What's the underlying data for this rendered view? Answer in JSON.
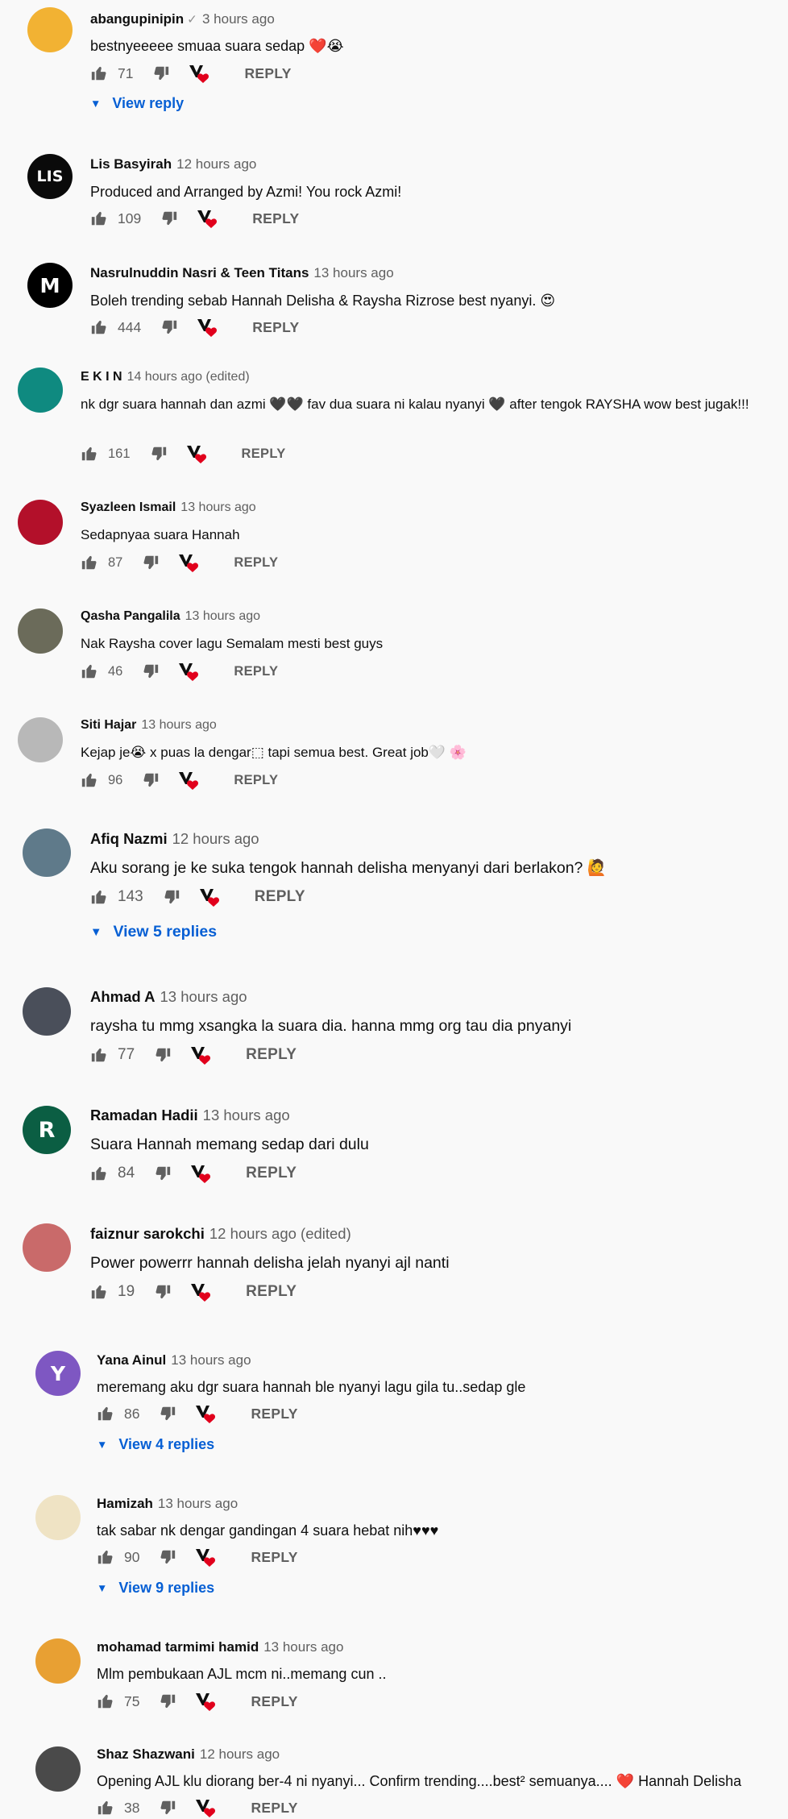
{
  "comments": [
    {
      "author": "abangupinipin",
      "time": "3 hours ago",
      "verified_mark": "✓",
      "text": "bestnyeeeee smuaa suara sedap ❤️😭",
      "likes": "71",
      "reply_label": "REPLY",
      "view_replies": "View reply",
      "avatar_color": "#f2b233",
      "avatar_letter": ""
    },
    {
      "author": "Lis Basyirah",
      "time": "12 hours ago",
      "text": "Produced and Arranged by Azmi! You rock Azmi!",
      "likes": "109",
      "reply_label": "REPLY",
      "avatar_color": "#0a0a0a",
      "avatar_letter": "LIS"
    },
    {
      "author": "Nasrulnuddin Nasri & Teen Titans",
      "time": "13 hours ago",
      "text": "Boleh trending sebab Hannah Delisha & Raysha Rizrose best nyanyi. 😍",
      "likes": "444",
      "reply_label": "REPLY",
      "avatar_color": "#000000",
      "avatar_letter": "M"
    },
    {
      "author": "E K I N",
      "time": "14 hours ago (edited)",
      "text": "nk dgr suara hannah dan azmi 🖤🖤 fav dua suara ni kalau nyanyi 🖤 after tengok RAYSHA wow best jugak!!!",
      "likes": "161",
      "reply_label": "REPLY",
      "avatar_color": "#0f8a80",
      "avatar_letter": ""
    },
    {
      "author": "Syazleen Ismail",
      "time": "13 hours ago",
      "text": "Sedapnyaa suara Hannah",
      "likes": "87",
      "reply_label": "REPLY",
      "avatar_color": "#b3102a",
      "avatar_letter": ""
    },
    {
      "author": "Qasha Pangalila",
      "time": "13 hours ago",
      "text": "Nak Raysha cover lagu Semalam mesti best guys",
      "likes": "46",
      "reply_label": "REPLY",
      "avatar_color": "#6b6b5a",
      "avatar_letter": ""
    },
    {
      "author": "Siti Hajar",
      "time": "13 hours ago",
      "text": "Kejap je😭 x puas la dengar⬚ tapi semua best. Great job🤍 🌸",
      "likes": "96",
      "reply_label": "REPLY",
      "avatar_color": "#b8b8b8",
      "avatar_letter": ""
    },
    {
      "author": "Afiq Nazmi",
      "time": "12 hours ago",
      "text": "Aku sorang je ke suka tengok hannah delisha menyanyi dari berlakon? 🙋",
      "likes": "143",
      "reply_label": "REPLY",
      "view_replies": "View 5 replies",
      "avatar_color": "#5f7a8a",
      "avatar_letter": ""
    },
    {
      "author": "Ahmad A",
      "time": "13 hours ago",
      "text": "raysha tu mmg xsangka la suara dia. hanna mmg org tau dia pnyanyi",
      "likes": "77",
      "reply_label": "REPLY",
      "avatar_color": "#4a4f5a",
      "avatar_letter": ""
    },
    {
      "author": "Ramadan Hadii",
      "time": "13 hours ago",
      "text": "Suara Hannah memang sedap dari dulu",
      "likes": "84",
      "reply_label": "REPLY",
      "avatar_color": "#0b5e43",
      "avatar_letter": "R"
    },
    {
      "author": "faiznur sarokchi",
      "time": "12 hours ago (edited)",
      "text": "Power powerrr hannah delisha jelah nyanyi ajl nanti",
      "likes": "19",
      "reply_label": "REPLY",
      "avatar_color": "#c96a6a",
      "avatar_letter": ""
    },
    {
      "author": "Yana Ainul",
      "time": "13 hours ago",
      "text": "meremang aku dgr suara hannah ble nyanyi lagu gila tu..sedap gle",
      "likes": "86",
      "reply_label": "REPLY",
      "view_replies": "View 4 replies",
      "avatar_color": "#7e57c2",
      "avatar_letter": "Y"
    },
    {
      "author": "Hamizah",
      "time": "13 hours ago",
      "text": "tak sabar nk dengar gandingan 4 suara hebat nih♥♥♥",
      "likes": "90",
      "reply_label": "REPLY",
      "view_replies": "View 9 replies",
      "avatar_color": "#efe3c4",
      "avatar_letter": ""
    },
    {
      "author": "mohamad tarmimi hamid",
      "time": "13 hours ago",
      "text": "Mlm pembukaan AJL mcm ni..memang cun ..",
      "likes": "75",
      "reply_label": "REPLY",
      "avatar_color": "#e8a033",
      "avatar_letter": ""
    },
    {
      "author": "Shaz Shazwani",
      "time": "12 hours ago",
      "text": "Opening AJL klu diorang ber-4 ni nyanyi... Confirm trending....best² semuanya.... ❤️ Hannah Delisha",
      "likes": "38",
      "reply_label": "REPLY",
      "avatar_color": "#4a4a4a",
      "avatar_letter": ""
    }
  ]
}
